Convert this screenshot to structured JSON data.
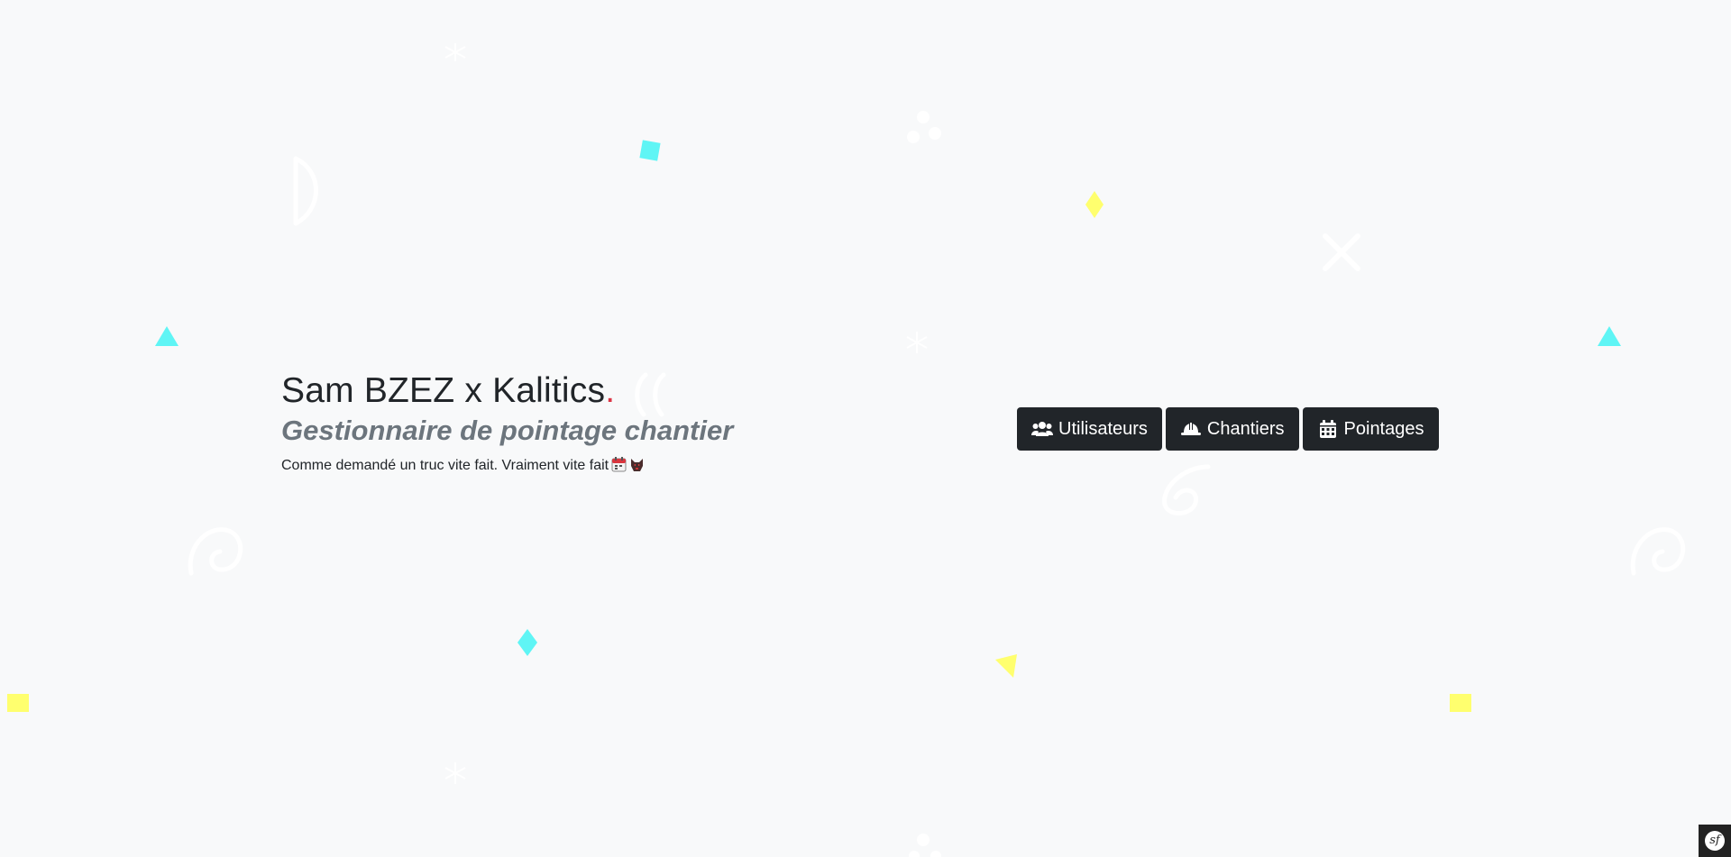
{
  "hero": {
    "title": "Sam BZEZ x Kalitics",
    "title_dot": ".",
    "subtitle": "Gestionnaire de pointage chantier",
    "tagline": "Comme demandé un truc vite fait. Vraiment vite fait"
  },
  "nav": {
    "buttons": [
      {
        "label": "Utilisateurs",
        "icon": "users-icon"
      },
      {
        "label": "Chantiers",
        "icon": "hard-hat-icon"
      },
      {
        "label": "Pointages",
        "icon": "calendar-icon"
      }
    ]
  },
  "toolbar": {
    "logo": "sf",
    "icon": "symfony-icon"
  },
  "colors": {
    "background": "#f8f9fa",
    "button": "#212529",
    "accent_dot": "#dc3545",
    "subtitle": "#6c757d",
    "confetti_cyan": "#5ff5f5",
    "confetti_yellow": "#ffff6e"
  }
}
